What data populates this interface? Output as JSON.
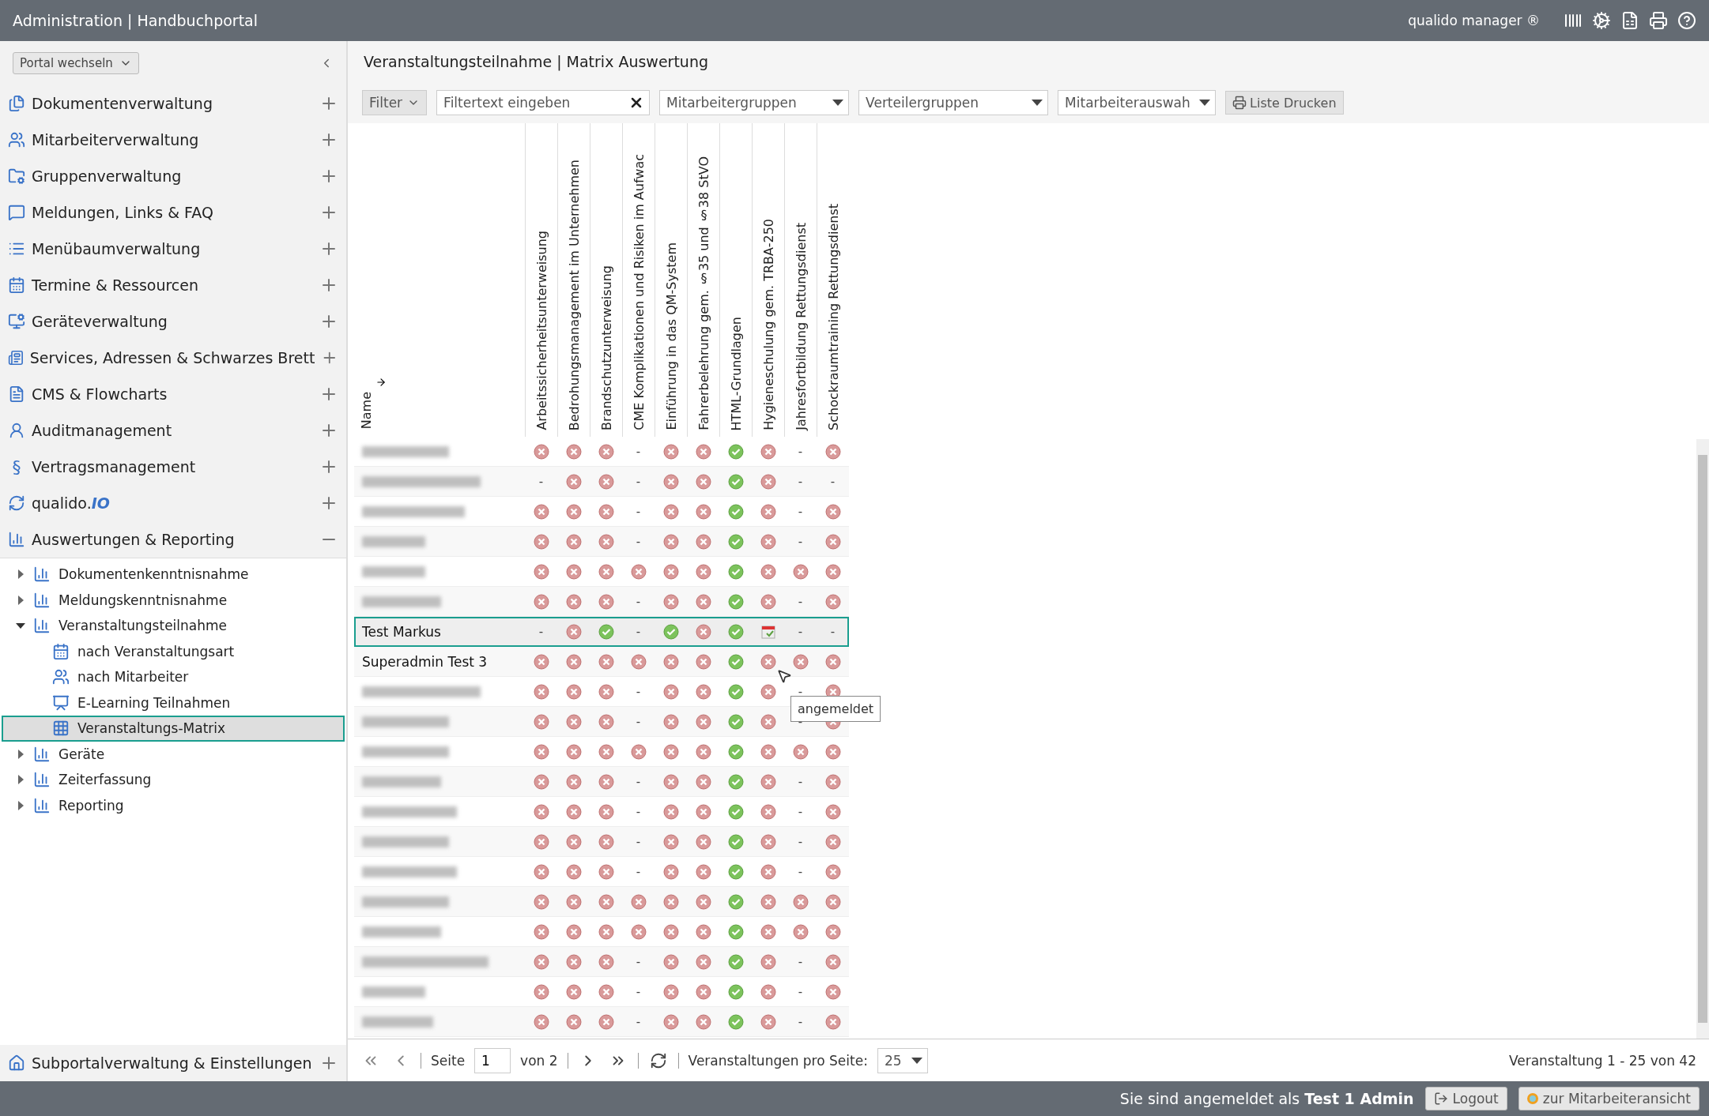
{
  "topbar": {
    "title": "Administration | Handbuchportal",
    "product": "qualido manager ®"
  },
  "sidebar": {
    "portal_switch": "Portal wechseln",
    "items": [
      {
        "label": "Dokumentenverwaltung",
        "expanded": false
      },
      {
        "label": "Mitarbeiterverwaltung",
        "expanded": false
      },
      {
        "label": "Gruppenverwaltung",
        "expanded": false
      },
      {
        "label": "Meldungen, Links & FAQ",
        "expanded": false
      },
      {
        "label": "Menübaumverwaltung",
        "expanded": false
      },
      {
        "label": "Termine & Ressourcen",
        "expanded": false
      },
      {
        "label": "Geräteverwaltung",
        "expanded": false
      },
      {
        "label": "Services, Adressen & Schwarzes Brett",
        "expanded": false
      },
      {
        "label": "CMS & Flowcharts",
        "expanded": false
      },
      {
        "label": "Auditmanagement",
        "expanded": false
      },
      {
        "label": "Vertragsmanagement",
        "icon_text": "§",
        "expanded": false
      },
      {
        "label": "qualido.",
        "label_suffix": "IO",
        "expanded": false
      },
      {
        "label": "Auswertungen & Reporting",
        "expanded": true
      }
    ],
    "tree": [
      {
        "label": "Dokumentenkenntnisnahme",
        "expanded": false,
        "selected": false
      },
      {
        "label": "Meldungskenntnisnahme",
        "expanded": false,
        "selected": false
      },
      {
        "label": "Veranstaltungsteilnahme",
        "expanded": true,
        "selected": false,
        "children": [
          {
            "label": "nach Veranstaltungsart",
            "selected": false
          },
          {
            "label": "nach Mitarbeiter",
            "selected": false
          },
          {
            "label": "E-Learning Teilnahmen",
            "selected": false
          },
          {
            "label": "Veranstaltungs-Matrix",
            "selected": true
          }
        ]
      },
      {
        "label": "Geräte",
        "expanded": false,
        "selected": false
      },
      {
        "label": "Zeiterfassung",
        "expanded": false,
        "selected": false
      },
      {
        "label": "Reporting",
        "expanded": false,
        "selected": false
      }
    ],
    "bottom_item": {
      "label": "Subportalverwaltung & Einstellungen"
    }
  },
  "main": {
    "title": "Veranstaltungsteilnahme | Matrix Auswertung",
    "toolbar": {
      "filter": "Filter",
      "filter_placeholder": "Filtertext eingeben",
      "dropdowns": [
        "Mitarbeitergruppen",
        "Verteilergruppen",
        "Mitarbeiterauswah"
      ],
      "print": "Liste Drucken"
    },
    "matrix": {
      "name_header": "Name",
      "dash": "-",
      "columns": [
        "Arbeitssicherheitsunterweisung",
        "Bedrohungsmanagement im Unternehmen",
        "Brandschutzunterweisung",
        "CME Komplikationen und Risiken im Aufwac",
        "Einführung in das QM-System",
        "Fahrerbelehrung gem. §35 und §38 StVO",
        "HTML-Grundlagen",
        "Hygieneschulung gem. TRBA-250",
        "Jahresfortbildung Rettungsdienst",
        "Schockraumtraining Rettungsdienst"
      ],
      "rows": [
        {
          "redacted": true,
          "selected": false,
          "cells": [
            {
              "kind": "failed"
            },
            {
              "kind": "failed"
            },
            {
              "kind": "failed"
            },
            {
              "kind": "none"
            },
            {
              "kind": "failed"
            },
            {
              "kind": "failed"
            },
            {
              "kind": "passed"
            },
            {
              "kind": "failed"
            },
            {
              "kind": "none"
            },
            {
              "kind": "failed"
            }
          ]
        },
        {
          "redacted": true,
          "selected": false,
          "cells": [
            {
              "kind": "none"
            },
            {
              "kind": "failed"
            },
            {
              "kind": "failed"
            },
            {
              "kind": "none"
            },
            {
              "kind": "failed"
            },
            {
              "kind": "failed"
            },
            {
              "kind": "passed"
            },
            {
              "kind": "failed"
            },
            {
              "kind": "none"
            },
            {
              "kind": "none"
            }
          ]
        },
        {
          "redacted": true,
          "selected": false,
          "cells": [
            {
              "kind": "failed"
            },
            {
              "kind": "failed"
            },
            {
              "kind": "failed"
            },
            {
              "kind": "none"
            },
            {
              "kind": "failed"
            },
            {
              "kind": "failed"
            },
            {
              "kind": "passed"
            },
            {
              "kind": "failed"
            },
            {
              "kind": "none"
            },
            {
              "kind": "failed"
            }
          ]
        },
        {
          "redacted": true,
          "selected": false,
          "cells": [
            {
              "kind": "failed"
            },
            {
              "kind": "failed"
            },
            {
              "kind": "failed"
            },
            {
              "kind": "none"
            },
            {
              "kind": "failed"
            },
            {
              "kind": "failed"
            },
            {
              "kind": "passed"
            },
            {
              "kind": "failed"
            },
            {
              "kind": "none"
            },
            {
              "kind": "failed"
            }
          ]
        },
        {
          "redacted": true,
          "selected": false,
          "cells": [
            {
              "kind": "failed"
            },
            {
              "kind": "failed"
            },
            {
              "kind": "failed"
            },
            {
              "kind": "failed"
            },
            {
              "kind": "failed"
            },
            {
              "kind": "failed"
            },
            {
              "kind": "passed"
            },
            {
              "kind": "failed"
            },
            {
              "kind": "failed"
            },
            {
              "kind": "failed"
            }
          ]
        },
        {
          "redacted": true,
          "selected": false,
          "cells": [
            {
              "kind": "failed"
            },
            {
              "kind": "failed"
            },
            {
              "kind": "failed"
            },
            {
              "kind": "none"
            },
            {
              "kind": "failed"
            },
            {
              "kind": "failed"
            },
            {
              "kind": "passed"
            },
            {
              "kind": "failed"
            },
            {
              "kind": "none"
            },
            {
              "kind": "failed"
            }
          ]
        },
        {
          "name": "Test Markus",
          "selected": true,
          "cells": [
            {
              "kind": "none"
            },
            {
              "kind": "failed"
            },
            {
              "kind": "passed"
            },
            {
              "kind": "none"
            },
            {
              "kind": "passed"
            },
            {
              "kind": "failed"
            },
            {
              "kind": "passed"
            },
            {
              "kind": "registered"
            },
            {
              "kind": "none"
            },
            {
              "kind": "none"
            }
          ]
        },
        {
          "name": "Superadmin Test 3",
          "selected": false,
          "cells": [
            {
              "kind": "failed"
            },
            {
              "kind": "failed"
            },
            {
              "kind": "failed"
            },
            {
              "kind": "failed"
            },
            {
              "kind": "failed"
            },
            {
              "kind": "failed"
            },
            {
              "kind": "passed"
            },
            {
              "kind": "failed"
            },
            {
              "kind": "failed"
            },
            {
              "kind": "failed"
            }
          ]
        },
        {
          "redacted": true,
          "selected": false,
          "cells": [
            {
              "kind": "failed"
            },
            {
              "kind": "failed"
            },
            {
              "kind": "failed"
            },
            {
              "kind": "none"
            },
            {
              "kind": "failed"
            },
            {
              "kind": "failed"
            },
            {
              "kind": "passed"
            },
            {
              "kind": "failed"
            },
            {
              "kind": "none"
            },
            {
              "kind": "failed"
            }
          ]
        },
        {
          "redacted": true,
          "selected": false,
          "cells": [
            {
              "kind": "failed"
            },
            {
              "kind": "failed"
            },
            {
              "kind": "failed"
            },
            {
              "kind": "none"
            },
            {
              "kind": "failed"
            },
            {
              "kind": "failed"
            },
            {
              "kind": "passed"
            },
            {
              "kind": "failed"
            },
            {
              "kind": "none"
            },
            {
              "kind": "failed"
            }
          ]
        },
        {
          "redacted": true,
          "selected": false,
          "cells": [
            {
              "kind": "failed"
            },
            {
              "kind": "failed"
            },
            {
              "kind": "failed"
            },
            {
              "kind": "failed"
            },
            {
              "kind": "failed"
            },
            {
              "kind": "failed"
            },
            {
              "kind": "passed"
            },
            {
              "kind": "failed"
            },
            {
              "kind": "failed"
            },
            {
              "kind": "failed"
            }
          ]
        },
        {
          "redacted": true,
          "selected": false,
          "cells": [
            {
              "kind": "failed"
            },
            {
              "kind": "failed"
            },
            {
              "kind": "failed"
            },
            {
              "kind": "none"
            },
            {
              "kind": "failed"
            },
            {
              "kind": "failed"
            },
            {
              "kind": "passed"
            },
            {
              "kind": "failed"
            },
            {
              "kind": "none"
            },
            {
              "kind": "failed"
            }
          ]
        },
        {
          "redacted": true,
          "selected": false,
          "cells": [
            {
              "kind": "failed"
            },
            {
              "kind": "failed"
            },
            {
              "kind": "failed"
            },
            {
              "kind": "none"
            },
            {
              "kind": "failed"
            },
            {
              "kind": "failed"
            },
            {
              "kind": "passed"
            },
            {
              "kind": "failed"
            },
            {
              "kind": "none"
            },
            {
              "kind": "failed"
            }
          ]
        },
        {
          "redacted": true,
          "selected": false,
          "cells": [
            {
              "kind": "failed"
            },
            {
              "kind": "failed"
            },
            {
              "kind": "failed"
            },
            {
              "kind": "none"
            },
            {
              "kind": "failed"
            },
            {
              "kind": "failed"
            },
            {
              "kind": "passed"
            },
            {
              "kind": "failed"
            },
            {
              "kind": "none"
            },
            {
              "kind": "failed"
            }
          ]
        },
        {
          "redacted": true,
          "selected": false,
          "cells": [
            {
              "kind": "failed"
            },
            {
              "kind": "failed"
            },
            {
              "kind": "failed"
            },
            {
              "kind": "none"
            },
            {
              "kind": "failed"
            },
            {
              "kind": "failed"
            },
            {
              "kind": "passed"
            },
            {
              "kind": "failed"
            },
            {
              "kind": "none"
            },
            {
              "kind": "failed"
            }
          ]
        },
        {
          "redacted": true,
          "selected": false,
          "cells": [
            {
              "kind": "failed"
            },
            {
              "kind": "failed"
            },
            {
              "kind": "failed"
            },
            {
              "kind": "failed"
            },
            {
              "kind": "failed"
            },
            {
              "kind": "failed"
            },
            {
              "kind": "passed"
            },
            {
              "kind": "failed"
            },
            {
              "kind": "failed"
            },
            {
              "kind": "failed"
            }
          ]
        },
        {
          "redacted": true,
          "selected": false,
          "cells": [
            {
              "kind": "failed"
            },
            {
              "kind": "failed"
            },
            {
              "kind": "failed"
            },
            {
              "kind": "failed"
            },
            {
              "kind": "failed"
            },
            {
              "kind": "failed"
            },
            {
              "kind": "passed"
            },
            {
              "kind": "failed"
            },
            {
              "kind": "failed"
            },
            {
              "kind": "failed"
            }
          ]
        },
        {
          "redacted": true,
          "selected": false,
          "cells": [
            {
              "kind": "failed"
            },
            {
              "kind": "failed"
            },
            {
              "kind": "failed"
            },
            {
              "kind": "none"
            },
            {
              "kind": "failed"
            },
            {
              "kind": "failed"
            },
            {
              "kind": "passed"
            },
            {
              "kind": "failed"
            },
            {
              "kind": "none"
            },
            {
              "kind": "failed"
            }
          ]
        },
        {
          "redacted": true,
          "selected": false,
          "cells": [
            {
              "kind": "failed"
            },
            {
              "kind": "failed"
            },
            {
              "kind": "failed"
            },
            {
              "kind": "none"
            },
            {
              "kind": "failed"
            },
            {
              "kind": "failed"
            },
            {
              "kind": "passed"
            },
            {
              "kind": "failed"
            },
            {
              "kind": "none"
            },
            {
              "kind": "failed"
            }
          ]
        },
        {
          "redacted": true,
          "selected": false,
          "cells": [
            {
              "kind": "failed"
            },
            {
              "kind": "failed"
            },
            {
              "kind": "failed"
            },
            {
              "kind": "none"
            },
            {
              "kind": "failed"
            },
            {
              "kind": "failed"
            },
            {
              "kind": "passed"
            },
            {
              "kind": "failed"
            },
            {
              "kind": "none"
            },
            {
              "kind": "failed"
            }
          ]
        }
      ],
      "tooltip": "angemeldet"
    },
    "pager": {
      "page_label": "Seite",
      "page": "1",
      "of": "von 2",
      "per_page_label": "Veranstaltungen pro Seite:",
      "per_page": "25",
      "summary": "Veranstaltung 1 - 25 von 42"
    }
  },
  "footer": {
    "login": "Sie sind angemeldet als **Test 1 Admin**",
    "logout": "Logout",
    "switch_view": "zur Mitarbeiteransicht"
  }
}
